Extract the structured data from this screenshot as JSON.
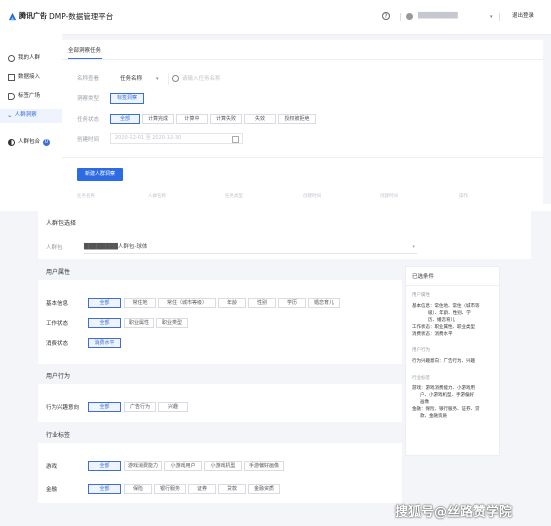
{
  "header": {
    "logo_text": "腾讯广告",
    "product_title": "DMP-数据管理平台",
    "user_blurred": "████████████",
    "logout": "退出登录"
  },
  "sidebar": {
    "items": [
      {
        "label": "我的人群",
        "icon": "person-circle-icon"
      },
      {
        "label": "数据接入",
        "icon": "database-icon"
      },
      {
        "label": "标签广场",
        "icon": "tag-icon"
      },
      {
        "label": "人群洞察",
        "icon": "chart-icon",
        "active": true
      },
      {
        "label": "人群包合",
        "icon": "merge-icon",
        "badge": "0"
      }
    ]
  },
  "insight": {
    "tab": "全部洞察任务",
    "filters": {
      "name_label": "名称查看",
      "name_select": "任务名称",
      "search_placeholder": "请输入任务名称",
      "type_label": "洞察类型",
      "type_value": "标签洞察",
      "status_label": "任务状态",
      "status_options": [
        "全部",
        "计算完成",
        "计算中",
        "计算失败",
        "失效",
        "授权被拒绝"
      ],
      "date_label": "创建时间",
      "date_range": "2020-12-01 至 2020-12-30"
    },
    "new_button": "新建人群洞察",
    "table_headers": [
      "任务名称",
      "人群名称",
      "任务类型",
      "创建时间",
      "创建时间",
      "操作"
    ]
  },
  "builder": {
    "pkg_section": "人群包选择",
    "pkg_label": "人群包",
    "pkg_value": "████████人群包-球体",
    "attr": {
      "title": "用户属性",
      "rows": [
        {
          "label": "基本信息",
          "options": [
            "全部",
            "常住地",
            "常住（城市等级）",
            "年龄",
            "性别",
            "学历",
            "婚恋育儿"
          ]
        },
        {
          "label": "工作状态",
          "options": [
            "全部",
            "职业属性",
            "职业类型"
          ]
        },
        {
          "label": "消费状态",
          "options": [
            "消费水平"
          ]
        }
      ]
    },
    "behavior": {
      "title": "用户行为",
      "rows": [
        {
          "label": "行为兴趣意向",
          "options": [
            "全部",
            "广告行为",
            "兴趣"
          ]
        }
      ]
    },
    "industry": {
      "title": "行业标签",
      "rows": [
        {
          "label": "游戏",
          "options": [
            "全部",
            "游戏消费能力",
            "小游戏用户",
            "小游戏机型",
            "手游偏好画像"
          ]
        },
        {
          "label": "金融",
          "options": [
            "全部",
            "保险",
            "银行服务",
            "证券",
            "贷款",
            "金融资质"
          ]
        }
      ]
    },
    "selected": {
      "title": "已选条件",
      "attr_title": "用户属性",
      "attr_lines": [
        "基本信息：常住地、常住（城市等",
        "级）、年龄、性别、学",
        "历、婚恋育儿",
        "工作状态：职业属性、职业类型",
        "消费状态：消费水平"
      ],
      "behavior_title": "用户行为",
      "behavior_lines": [
        "行为兴趣意向：广告行为、兴趣"
      ],
      "industry_title": "行业标签",
      "industry_lines": [
        "游戏：游戏消费能力、小游戏用",
        "户、小游戏机型、手游偏好",
        "画像",
        "金融：保险、银行服务、证券、贷",
        "款、金融资质"
      ]
    }
  },
  "watermark": "搜狐号@丝路赞学院",
  "colors": {
    "accent": "#3a6fd8",
    "header_bg": "#ffffff",
    "page_bg": "#f4f5f8"
  }
}
